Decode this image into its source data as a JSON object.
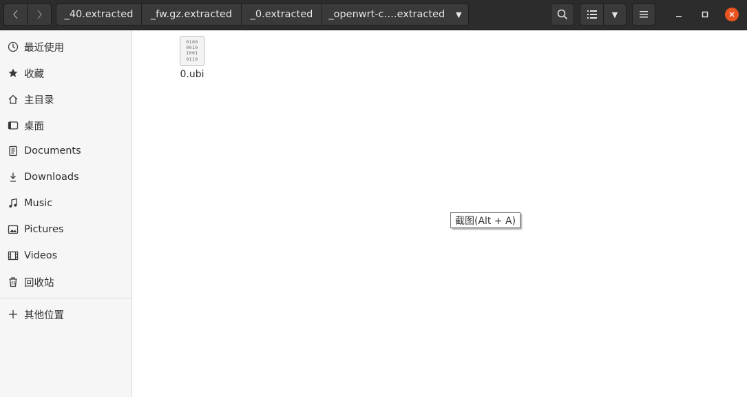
{
  "path_bar": {
    "crumbs": [
      "_40.extracted",
      "_fw.gz.extracted",
      "_0.extracted",
      "_openwrt-c….extracted"
    ]
  },
  "icons": {
    "back": "chevron-left-icon",
    "forward": "chevron-right-icon",
    "search": "search-icon",
    "list_view": "list-view-icon",
    "view_options": "caret-down-icon",
    "menu": "hamburger-menu-icon",
    "minimize": "minimize-icon",
    "maximize": "maximize-icon",
    "close": "close-icon"
  },
  "sidebar": {
    "items": [
      {
        "label": "最近使用",
        "icon": "clock-icon"
      },
      {
        "label": "收藏",
        "icon": "star-icon"
      },
      {
        "label": "主目录",
        "icon": "home-icon"
      },
      {
        "label": "桌面",
        "icon": "desktop-icon"
      },
      {
        "label": "Documents",
        "icon": "document-icon"
      },
      {
        "label": "Downloads",
        "icon": "download-icon"
      },
      {
        "label": "Music",
        "icon": "music-icon"
      },
      {
        "label": "Pictures",
        "icon": "picture-icon"
      },
      {
        "label": "Videos",
        "icon": "video-icon"
      },
      {
        "label": "回收站",
        "icon": "trash-icon"
      }
    ],
    "other_locations": {
      "label": "其他位置",
      "icon": "plus-icon"
    }
  },
  "files": [
    {
      "name": "0.ubi",
      "icon": "binary-file-icon",
      "icon_text": [
        "0100",
        "0010",
        "1001",
        "0110"
      ]
    }
  ],
  "tooltip": "截图(Alt + A)",
  "colors": {
    "header_bg": "#2c2c2c",
    "sidebar_bg": "#f6f6f6",
    "close_button": "#e95420"
  }
}
